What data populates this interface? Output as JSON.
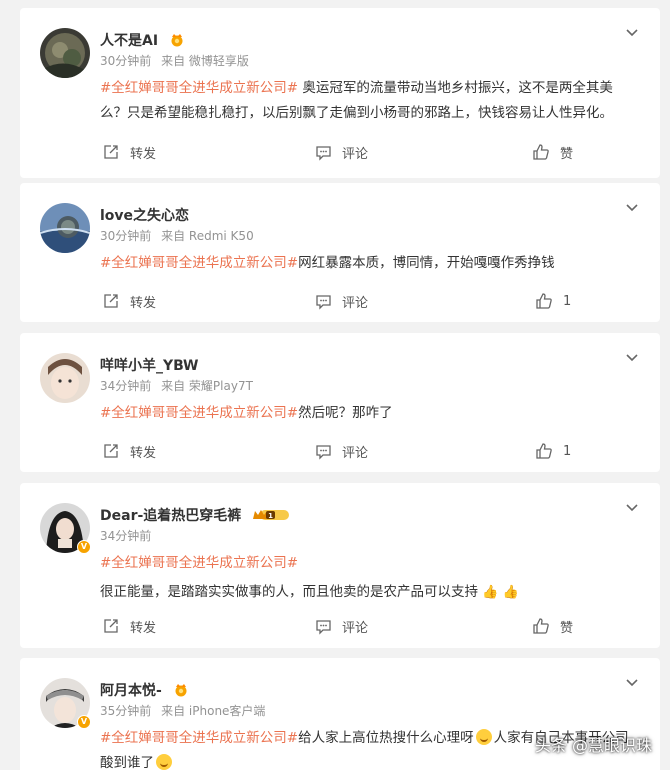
{
  "posts": [
    {
      "username": "人不是AI",
      "badge": "crown-flower-icon",
      "time": "30分钟前",
      "source": "来自 微博轻享版",
      "topic": "#全红婵哥哥全进华成立新公司#",
      "text": " 奥运冠军的流量带动当地乡村振兴，这不是两全其美么？只是希望能稳扎稳打，以后别飘了走偏到小杨哥的邪路上，快钱容易让人性异化。",
      "repost": "转发",
      "comment": "评论",
      "like": "赞"
    },
    {
      "username": "love之失心恋",
      "time": "30分钟前",
      "source": "来自 Redmi K50",
      "topic": "#全红婵哥哥全进华成立新公司#",
      "text": "网红暴露本质，博同情，开始嘎嘎作秀挣钱",
      "repost": "转发",
      "comment": "评论",
      "like": "1"
    },
    {
      "username": "咩咩小羊_YBW",
      "time": "34分钟前",
      "source": "来自 荣耀Play7T",
      "topic": "#全红婵哥哥全进华成立新公司#",
      "text": "然后呢？那咋了",
      "repost": "转发",
      "comment": "评论",
      "like": "1"
    },
    {
      "username": "Dear-追着热巴穿毛裤",
      "badge": "level-1-crown-badge",
      "badge_level": "1",
      "time": "34分钟前",
      "source": "",
      "topic": "#全红婵哥哥全进华成立新公司#",
      "text": "很正能量，是踏踏实实做事的人，而且他卖的是农产品可以支持",
      "emoji": "👍 👍",
      "repost": "转发",
      "comment": "评论",
      "like": "赞"
    },
    {
      "username": "阿月本悦-",
      "badge": "crown-flower-icon",
      "time": "35分钟前",
      "source": "来自 iPhone客户端",
      "topic": "#全红婵哥哥全进华成立新公司#",
      "text_a": "给人家上高位热搜什么心理呀",
      "text_b": "人家有自己本事开公司酸到谁了"
    }
  ],
  "watermark": "头条 @慧眼识珠",
  "colors": {
    "topic": "#eb7350",
    "meta": "#939393",
    "badge": "#f7a300"
  }
}
